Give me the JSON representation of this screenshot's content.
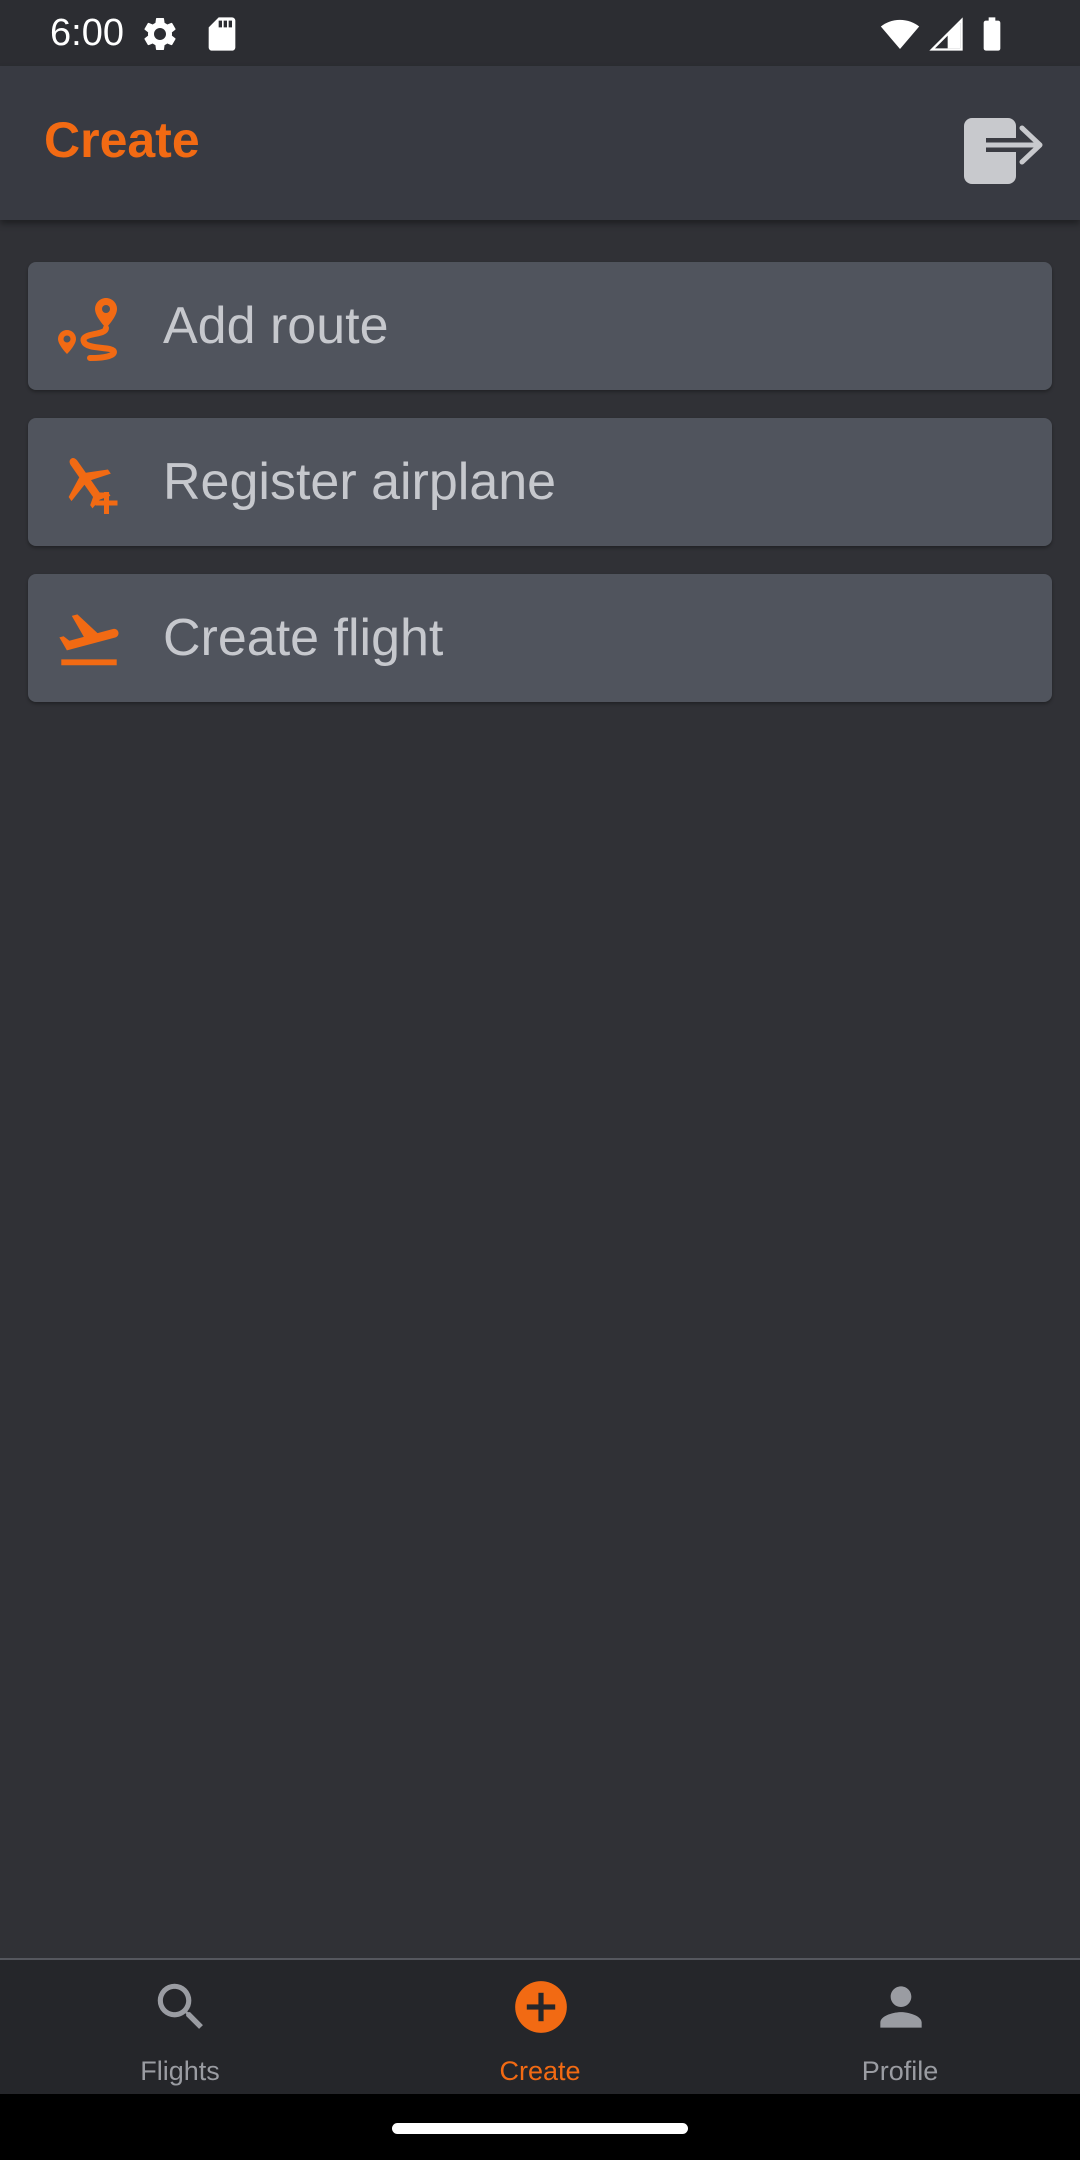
{
  "status_bar": {
    "time": "6:00",
    "icons": [
      "settings-gear-icon",
      "sd-card-icon",
      "wifi-icon",
      "cell-signal-icon",
      "battery-icon"
    ]
  },
  "app_bar": {
    "title": "Create",
    "logout_icon": "logout-icon"
  },
  "menu": {
    "items": [
      {
        "label": "Add route",
        "icon": "route-icon"
      },
      {
        "label": "Register airplane",
        "icon": "airplane-add-icon"
      },
      {
        "label": "Create flight",
        "icon": "flight-takeoff-icon"
      }
    ]
  },
  "bottom_nav": {
    "tabs": [
      {
        "label": "Flights",
        "icon": "search-icon",
        "active": false
      },
      {
        "label": "Create",
        "icon": "add-circle-icon",
        "active": true
      },
      {
        "label": "Profile",
        "icon": "person-icon",
        "active": false
      }
    ]
  },
  "colors": {
    "accent": "#f26a13",
    "background": "#303136",
    "app_bar": "#383a42",
    "card": "#50545d",
    "card_text": "#c6c8cd",
    "nav_inactive": "#9a9ca2"
  }
}
